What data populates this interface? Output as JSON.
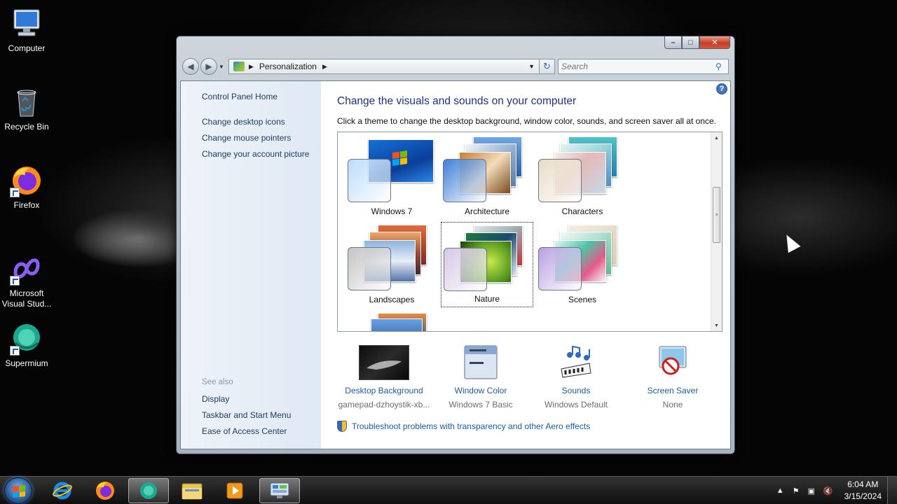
{
  "desktop": {
    "icons": [
      {
        "label": "Computer",
        "icon": "computer-icon"
      },
      {
        "label": "Recycle Bin",
        "icon": "recycle-bin-icon"
      },
      {
        "label": "Firefox",
        "icon": "firefox-icon"
      },
      {
        "label": "Microsoft Visual Stud...",
        "icon": "visual-studio-icon"
      },
      {
        "label": "Supermium",
        "icon": "supermium-icon"
      }
    ]
  },
  "window": {
    "address": {
      "location": "Personalization"
    },
    "search": {
      "placeholder": "Search"
    },
    "sidebar": {
      "links": [
        "Control Panel Home",
        "Change desktop icons",
        "Change mouse pointers",
        "Change your account picture"
      ],
      "see_also_heading": "See also",
      "see_also": [
        "Display",
        "Taskbar and Start Menu",
        "Ease of Access Center"
      ]
    },
    "main": {
      "title": "Change the visuals and sounds on your computer",
      "subtitle": "Click a theme to change the desktop background, window color, sounds, and screen saver all at once.",
      "themes": [
        {
          "label": "Windows 7",
          "glass_color": "#bcdcfb"
        },
        {
          "label": "Architecture",
          "glass_color": "#3f7fd8"
        },
        {
          "label": "Characters",
          "glass_color": "#e8dcc6"
        },
        {
          "label": "Landscapes",
          "glass_color": "#c4c4c4"
        },
        {
          "label": "Nature",
          "glass_color": "#d6c8e6"
        },
        {
          "label": "Scenes",
          "glass_color": "#b8a0e2"
        }
      ],
      "selected_theme": "Nature",
      "settings": [
        {
          "label": "Desktop Background",
          "value": "gamepad-dzhoystik-xb...",
          "icon": "desktop-background-icon"
        },
        {
          "label": "Window Color",
          "value": "Windows 7 Basic",
          "icon": "window-color-icon"
        },
        {
          "label": "Sounds",
          "value": "Windows Default",
          "icon": "sounds-icon"
        },
        {
          "label": "Screen Saver",
          "value": "None",
          "icon": "screen-saver-icon"
        }
      ],
      "troubleshoot_link": "Troubleshoot problems with transparency and other Aero effects"
    }
  },
  "taskbar": {
    "pinned": [
      "internet-explorer-icon",
      "firefox-icon",
      "supermium-icon",
      "file-explorer-icon",
      "media-player-icon",
      "control-panel-icon"
    ],
    "clock": {
      "time": "6:04 AM",
      "date": "3/15/2024"
    }
  }
}
